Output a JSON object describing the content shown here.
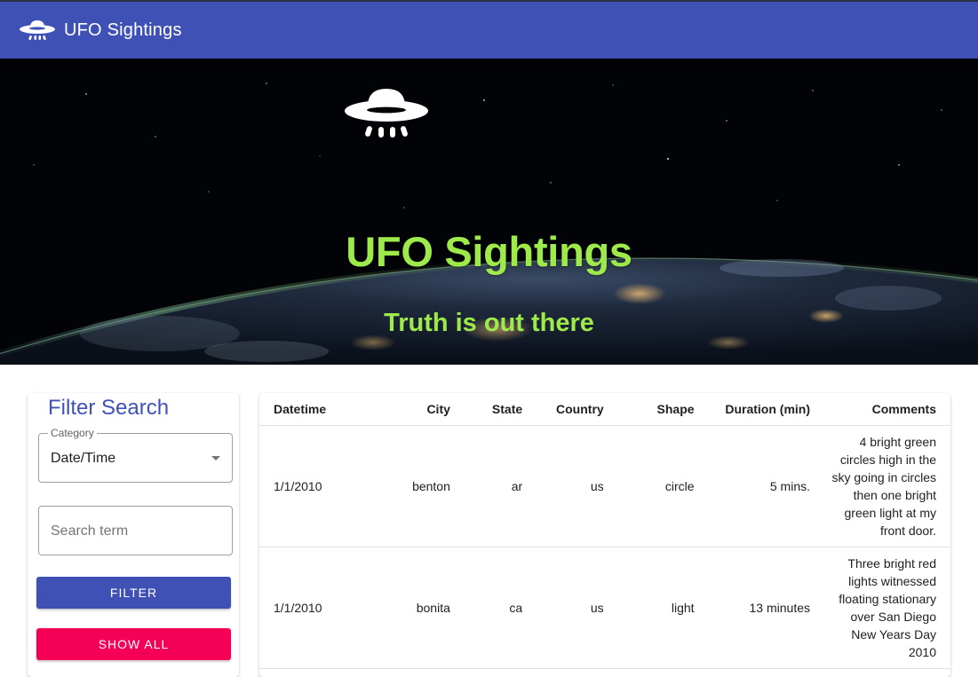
{
  "appbar": {
    "title": "UFO Sightings",
    "icon": "ufo-icon"
  },
  "hero": {
    "title": "UFO Sightings",
    "subtitle": "Truth is out there",
    "icon": "ufo-icon",
    "text_color": "#9dea4a"
  },
  "filter": {
    "title": "Filter Search",
    "category_label": "Category",
    "category_value": "Date/Time",
    "search_placeholder": "Search term",
    "search_value": "",
    "filter_button": "Filter",
    "show_all_button": "Show All"
  },
  "table": {
    "columns": [
      "Datetime",
      "City",
      "State",
      "Country",
      "Shape",
      "Duration (min)",
      "Comments"
    ],
    "rows": [
      [
        "1/1/2010",
        "benton",
        "ar",
        "us",
        "circle",
        "5 mins.",
        "4 bright green circles high in the sky going in circles then one bright green light at my front door."
      ],
      [
        "1/1/2010",
        "bonita",
        "ca",
        "us",
        "light",
        "13 minutes",
        "Three bright red lights witnessed floating stationary over San Diego New Years Day 2010"
      ]
    ]
  },
  "colors": {
    "primary": "#3f51b5",
    "secondary": "#f50057",
    "accent_text": "#9dea4a"
  }
}
